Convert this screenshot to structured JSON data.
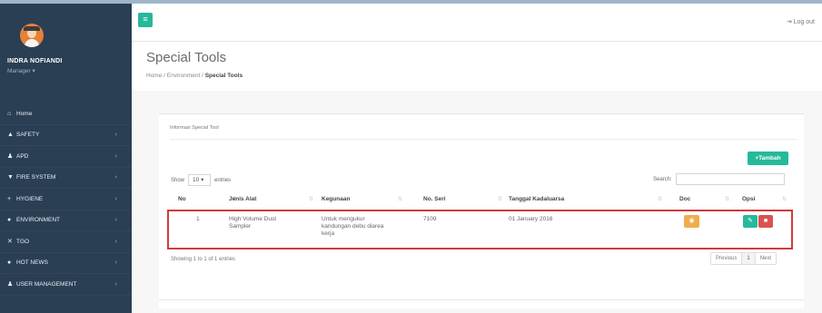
{
  "sidebar": {
    "user_name": "INDRA NOFIANDI",
    "user_role": "Manager ▾",
    "items": [
      {
        "label": "Home",
        "icon": "home-icon",
        "glyph": "⌂",
        "chevron": ""
      },
      {
        "label": "SAFETY",
        "icon": "thumbs-up-icon",
        "glyph": "▲",
        "chevron": "‹"
      },
      {
        "label": "APD",
        "icon": "user-icon",
        "glyph": "♟",
        "chevron": "‹"
      },
      {
        "label": "FIRE SYSTEM",
        "icon": "filter-icon",
        "glyph": "▼",
        "chevron": "‹"
      },
      {
        "label": "HYGIENE",
        "icon": "plus-icon",
        "glyph": "+",
        "chevron": "‹"
      },
      {
        "label": "ENVIRONMENT",
        "icon": "globe-icon",
        "glyph": "●",
        "chevron": "‹"
      },
      {
        "label": "TGO",
        "icon": "tools-icon",
        "glyph": "✕",
        "chevron": "‹"
      },
      {
        "label": "HOT NEWS",
        "icon": "globe-icon",
        "glyph": "●",
        "chevron": "‹"
      },
      {
        "label": "USER MANAGEMENT",
        "icon": "users-icon",
        "glyph": "♟",
        "chevron": "‹"
      }
    ]
  },
  "topbar": {
    "toggle_glyph": "≡",
    "logout_label": "⇥ Log out"
  },
  "header": {
    "title": "Special Tools",
    "breadcrumb": [
      "Home",
      "Environment",
      "Special Tools"
    ]
  },
  "panel": {
    "title": "Informasi Special Tool",
    "add_button": "+Tambah",
    "show_label": "Show",
    "entries_value": "10",
    "entries_label": "entries",
    "search_label": "Search:",
    "search_value": ""
  },
  "table": {
    "columns": [
      "No",
      "Jenis Alat",
      "Kegunaan",
      "No. Seri",
      "Tanggal Kadaluarsa",
      "Doc",
      "Opsi"
    ],
    "rows": [
      {
        "no": "1",
        "jenis_alat": [
          "High Volume Dust",
          "Sampler"
        ],
        "kegunaan": [
          "Untuk mengukur",
          "kandungan debu diarea",
          "kerja"
        ],
        "no_seri": "7109",
        "tanggal": "01 January 2018"
      }
    ]
  },
  "footer": {
    "showing": "Showing 1 to 1 of 1 entries",
    "prev": "Previous",
    "page": "1",
    "next": "Next"
  },
  "colors": {
    "sidebar": "#2a3f54",
    "accent_green": "#26b99a",
    "view_orange": "#f0ad4e",
    "delete_red": "#d9534f",
    "highlight_red": "#d23a3a"
  }
}
